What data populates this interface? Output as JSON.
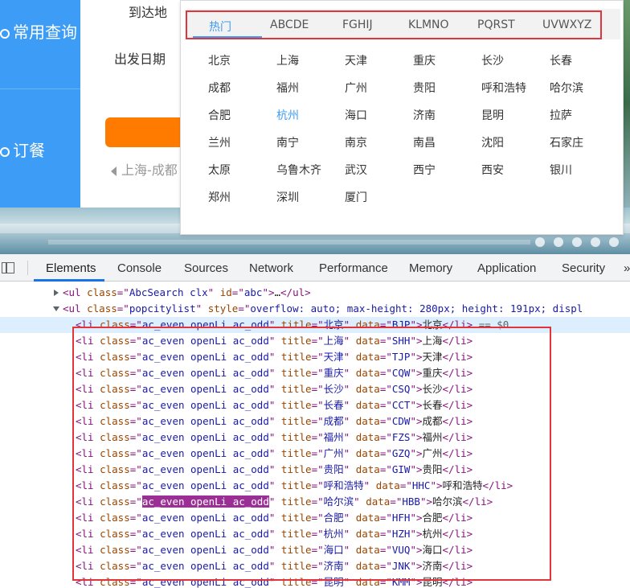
{
  "nav": {
    "query_label": "常用查询",
    "book_label": "订餐"
  },
  "form": {
    "arrive_label": "到达地",
    "depart_label": "出发日期",
    "route_text": "上海-成都"
  },
  "city_popup": {
    "tabs": [
      "热门",
      "ABCDE",
      "FGHIJ",
      "KLMNO",
      "PQRST",
      "UVWXYZ"
    ],
    "active_tab": "热门",
    "cities": [
      "北京",
      "上海",
      "天津",
      "重庆",
      "长沙",
      "长春",
      "成都",
      "福州",
      "广州",
      "贵阳",
      "呼和浩特",
      "哈尔滨",
      "合肥",
      "杭州",
      "海口",
      "济南",
      "昆明",
      "拉萨",
      "兰州",
      "南宁",
      "南京",
      "南昌",
      "沈阳",
      "石家庄",
      "太原",
      "乌鲁木齐",
      "武汉",
      "西宁",
      "西安",
      "银川",
      "郑州",
      "深圳",
      "厦门"
    ],
    "selected_city": "杭州"
  },
  "devtools": {
    "tabs": [
      "Elements",
      "Console",
      "Sources",
      "Network",
      "Performance",
      "Memory",
      "Application",
      "Security"
    ],
    "active_tab": "Elements",
    "overflow_marker": "»",
    "ul_abc": {
      "tag": "ul",
      "class": "AbcSearch clx",
      "id": "abc",
      "ellipsis": "…"
    },
    "ul_popcity": {
      "tag": "ul",
      "class": "popcitylist",
      "style": "overflow: auto; max-height: 280px; height: 191px; displ"
    },
    "li_class": "ac_even openLi ac_odd",
    "selected_marker": " == $0",
    "items": [
      {
        "title": "北京",
        "data": "BJP",
        "text": "北京"
      },
      {
        "title": "上海",
        "data": "SHH",
        "text": "上海"
      },
      {
        "title": "天津",
        "data": "TJP",
        "text": "天津"
      },
      {
        "title": "重庆",
        "data": "CQW",
        "text": "重庆"
      },
      {
        "title": "长沙",
        "data": "CSQ",
        "text": "长沙"
      },
      {
        "title": "长春",
        "data": "CCT",
        "text": "长春"
      },
      {
        "title": "成都",
        "data": "CDW",
        "text": "成都"
      },
      {
        "title": "福州",
        "data": "FZS",
        "text": "福州"
      },
      {
        "title": "广州",
        "data": "GZQ",
        "text": "广州"
      },
      {
        "title": "贵阳",
        "data": "GIW",
        "text": "贵阳"
      },
      {
        "title": "呼和浩特",
        "data": "HHC",
        "text": "呼和浩特"
      },
      {
        "title": "哈尔滨",
        "data": "HBB",
        "text": "哈尔滨"
      },
      {
        "title": "合肥",
        "data": "HFH",
        "text": "合肥"
      },
      {
        "title": "杭州",
        "data": "HZH",
        "text": "杭州"
      },
      {
        "title": "海口",
        "data": "VUQ",
        "text": "海口"
      },
      {
        "title": "济南",
        "data": "JNK",
        "text": "济南"
      },
      {
        "title": "昆明",
        "data": "KMM",
        "text": "昆明"
      }
    ]
  }
}
